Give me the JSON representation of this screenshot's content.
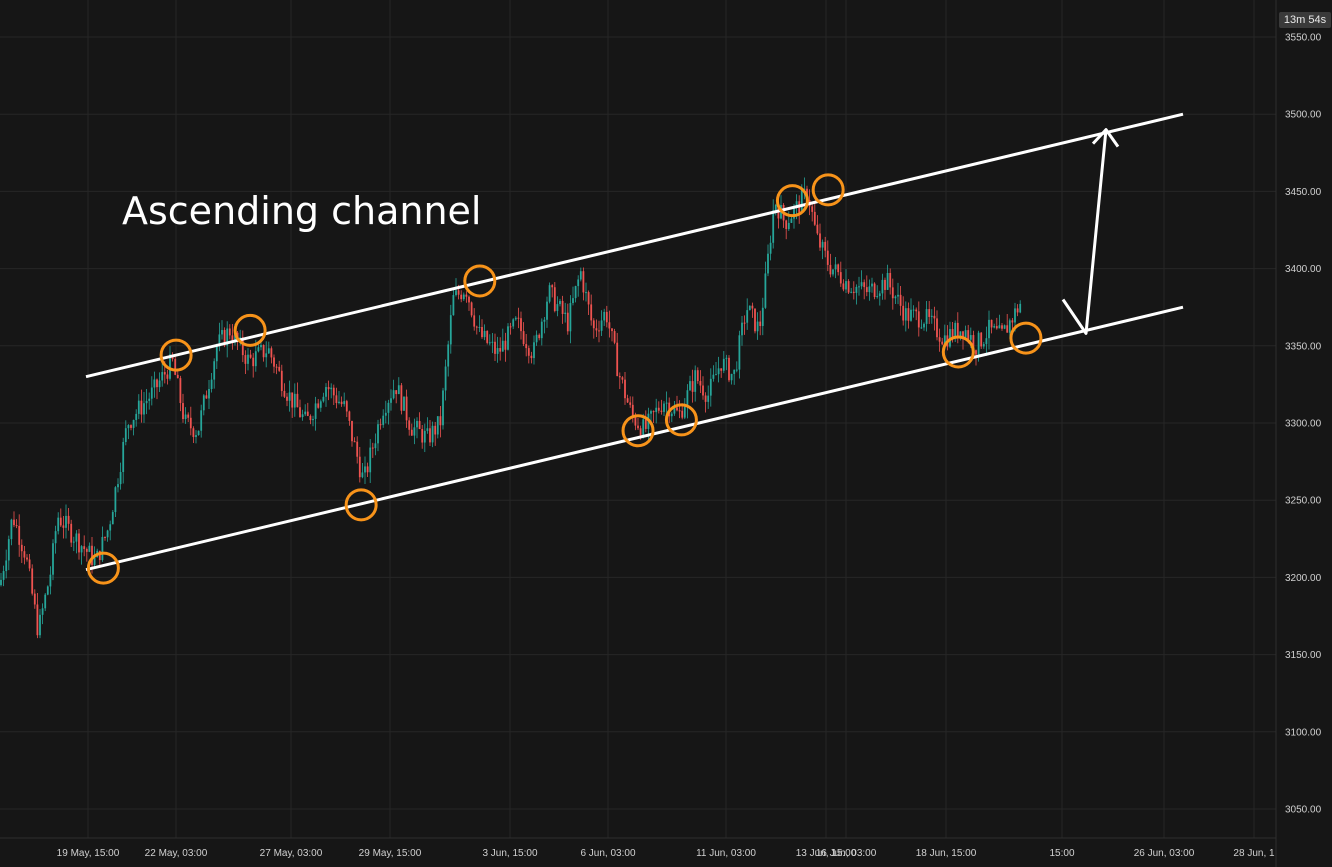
{
  "chart": {
    "annotation_text": "Ascending channel",
    "timer": "13m 54s",
    "colors": {
      "background": "#161616",
      "grid": "#262626",
      "up": "#26a69a",
      "down": "#ef5350",
      "channel": "#ffffff",
      "marker": "#f7931a",
      "text": "#d1d1d1"
    }
  },
  "chart_data": {
    "type": "candlestick",
    "title": "",
    "xlabel": "",
    "ylabel": "",
    "ylim": [
      3025,
      3560
    ],
    "y_ticks": [
      3050,
      3100,
      3150,
      3200,
      3250,
      3300,
      3350,
      3400,
      3450,
      3500,
      3550
    ],
    "y_tick_labels": [
      "3050.00",
      "3100.00",
      "3150.00",
      "3200.00",
      "3250.00",
      "3300.00",
      "3350.00",
      "3400.00",
      "3450.00",
      "3500.00",
      "3550.00"
    ],
    "x_ticks": [
      "19 May, 15:00",
      "22 May, 03:00",
      "27 May, 03:00",
      "29 May, 15:00",
      "3 Jun, 15:00",
      "6 Jun, 03:00",
      "11 Jun, 03:00",
      "13 Jun, 15:00",
      "16 Jun, 03:00",
      "18 Jun, 15:00",
      "15:00",
      "26 Jun, 03:00",
      "28 Jun, 1"
    ],
    "price_path": [
      [
        0,
        3195
      ],
      [
        0.01,
        3240
      ],
      [
        0.02,
        3215
      ],
      [
        0.03,
        3165
      ],
      [
        0.04,
        3205
      ],
      [
        0.045,
        3240
      ],
      [
        0.06,
        3225
      ],
      [
        0.075,
        3210
      ],
      [
        0.085,
        3232
      ],
      [
        0.1,
        3300
      ],
      [
        0.12,
        3320
      ],
      [
        0.135,
        3340
      ],
      [
        0.145,
        3300
      ],
      [
        0.155,
        3295
      ],
      [
        0.17,
        3350
      ],
      [
        0.18,
        3360
      ],
      [
        0.195,
        3340
      ],
      [
        0.21,
        3348
      ],
      [
        0.225,
        3320
      ],
      [
        0.24,
        3300
      ],
      [
        0.255,
        3325
      ],
      [
        0.27,
        3310
      ],
      [
        0.285,
        3262
      ],
      [
        0.3,
        3310
      ],
      [
        0.31,
        3325
      ],
      [
        0.322,
        3298
      ],
      [
        0.335,
        3290
      ],
      [
        0.345,
        3300
      ],
      [
        0.355,
        3380
      ],
      [
        0.365,
        3388
      ],
      [
        0.375,
        3358
      ],
      [
        0.39,
        3345
      ],
      [
        0.405,
        3365
      ],
      [
        0.418,
        3345
      ],
      [
        0.43,
        3385
      ],
      [
        0.445,
        3365
      ],
      [
        0.455,
        3398
      ],
      [
        0.465,
        3360
      ],
      [
        0.475,
        3372
      ],
      [
        0.485,
        3332
      ],
      [
        0.495,
        3305
      ],
      [
        0.505,
        3295
      ],
      [
        0.52,
        3315
      ],
      [
        0.532,
        3305
      ],
      [
        0.545,
        3330
      ],
      [
        0.555,
        3318
      ],
      [
        0.565,
        3340
      ],
      [
        0.575,
        3330
      ],
      [
        0.585,
        3375
      ],
      [
        0.595,
        3360
      ],
      [
        0.6,
        3392
      ],
      [
        0.607,
        3445
      ],
      [
        0.615,
        3430
      ],
      [
        0.625,
        3440
      ],
      [
        0.633,
        3450
      ],
      [
        0.64,
        3420
      ],
      [
        0.65,
        3402
      ],
      [
        0.665,
        3390
      ],
      [
        0.68,
        3385
      ],
      [
        0.695,
        3392
      ],
      [
        0.71,
        3370
      ],
      [
        0.725,
        3368
      ],
      [
        0.74,
        3355
      ],
      [
        0.755,
        3362
      ],
      [
        0.765,
        3350
      ],
      [
        0.775,
        3360
      ],
      [
        0.785,
        3356
      ],
      [
        0.8,
        3378
      ]
    ],
    "channel": {
      "upper": [
        [
          "19 May, 15:00",
          3330
        ],
        [
          "26 Jun, 03:00",
          3500
        ]
      ],
      "lower": [
        [
          "19 May, 15:00",
          3205
        ],
        [
          "26 Jun, 03:00",
          3375
        ]
      ]
    },
    "touch_points": [
      {
        "band": "lower",
        "x": 0.063,
        "price": 3206
      },
      {
        "band": "upper",
        "x": 0.12,
        "price": 3344
      },
      {
        "band": "upper",
        "x": 0.178,
        "price": 3360
      },
      {
        "band": "lower",
        "x": 0.265,
        "price": 3247
      },
      {
        "band": "upper",
        "x": 0.358,
        "price": 3392
      },
      {
        "band": "lower",
        "x": 0.482,
        "price": 3295
      },
      {
        "band": "lower",
        "x": 0.516,
        "price": 3302
      },
      {
        "band": "upper",
        "x": 0.603,
        "price": 3444
      },
      {
        "band": "upper",
        "x": 0.631,
        "price": 3451
      },
      {
        "band": "lower",
        "x": 0.733,
        "price": 3346
      },
      {
        "band": "lower",
        "x": 0.786,
        "price": 3355
      }
    ],
    "projection_arrow": {
      "from_price": 3360,
      "to_price": 3490
    }
  }
}
